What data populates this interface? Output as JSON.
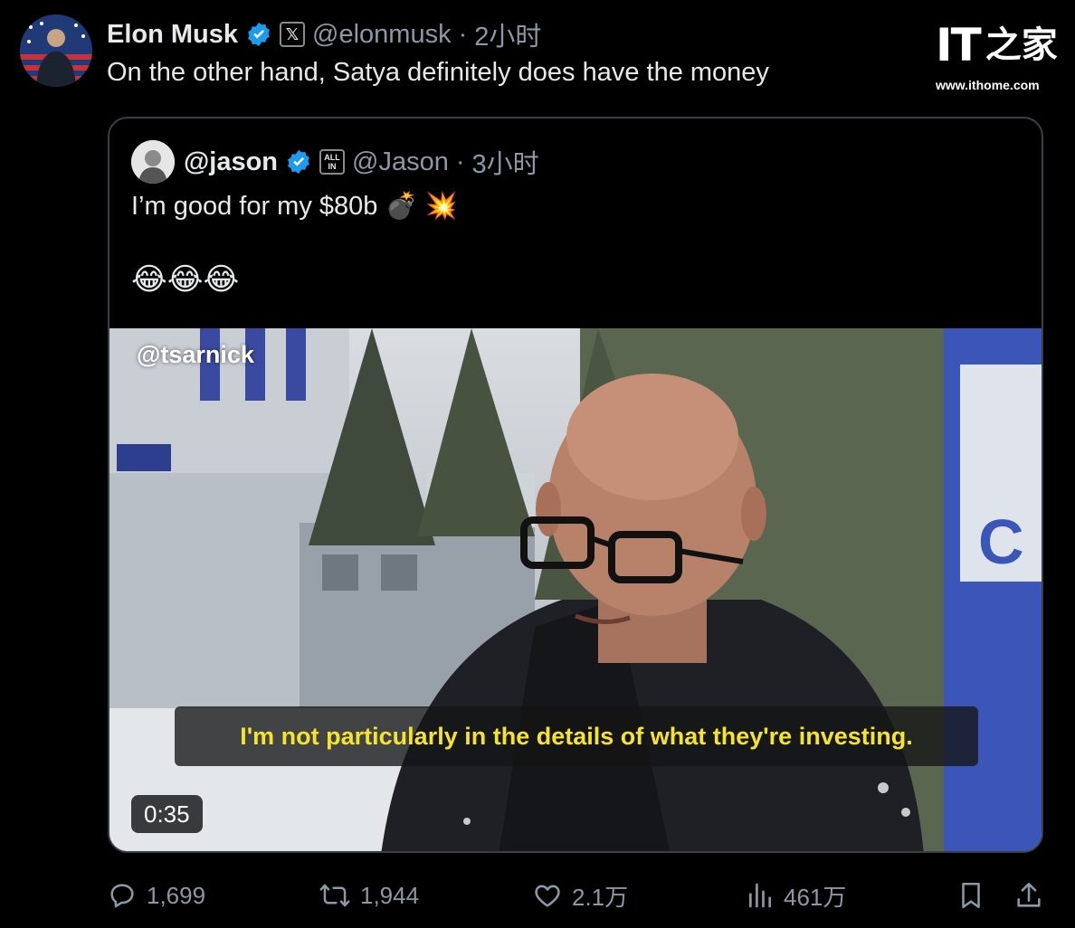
{
  "tweet": {
    "author_name": "Elon Musk",
    "handle": "@elonmusk",
    "separator": "·",
    "time": "2小时",
    "text": "On the other hand, Satya definitely does have the money",
    "avatar_icon": "person-flag-avatar"
  },
  "quoted": {
    "author_name": "@jason",
    "affiliate_badge": [
      "ALL",
      "IN"
    ],
    "handle": "@Jason",
    "separator": "·",
    "time": "3小时",
    "text": "I’m good for my $80b 💣 💥",
    "reaction": "😂😂😂",
    "video": {
      "credit": "@tsarnick",
      "caption": "I'm not particularly in the details of what they're investing.",
      "duration": "0:35"
    }
  },
  "actions": {
    "replies": "1,699",
    "reposts": "1,944",
    "likes": "2.1万",
    "views": "461万"
  },
  "watermark": {
    "logo_text": "IT",
    "logo_cn": "之家",
    "url": "www.ithome.com"
  },
  "colors": {
    "background": "#000000",
    "text": "#e7e9ea",
    "muted": "#8b98a5",
    "verified": "#1d9bf0",
    "caption": "#f5e32d"
  }
}
